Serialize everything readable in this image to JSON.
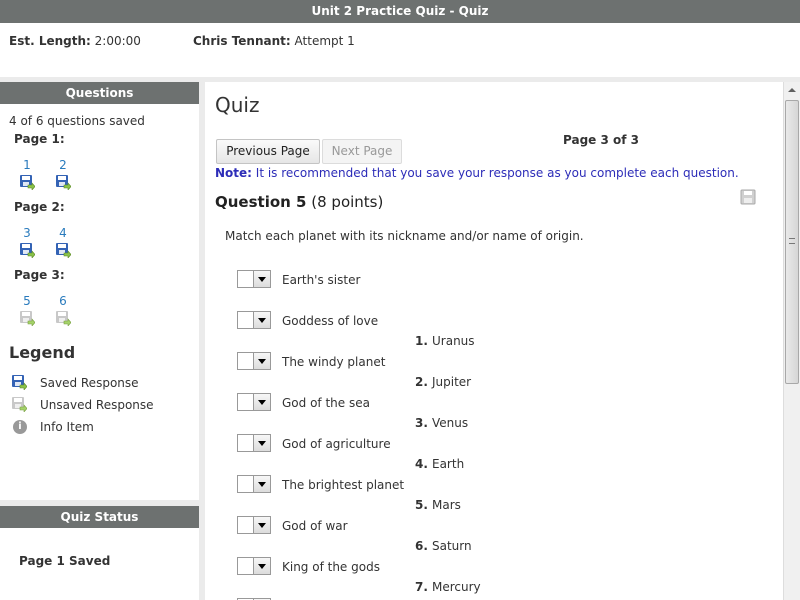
{
  "titlebar": {
    "title": "Unit 2 Practice Quiz - Quiz"
  },
  "meta": {
    "length_label": "Est. Length:",
    "length_value": "2:00:00",
    "user_name": "Chris Tennant:",
    "attempt": "Attempt 1"
  },
  "questions_panel": {
    "header": "Questions",
    "saved_count": "4 of 6 questions saved",
    "pages": [
      {
        "label": "Page 1:",
        "questions": [
          {
            "num": "1",
            "status": "saved"
          },
          {
            "num": "2",
            "status": "saved"
          }
        ]
      },
      {
        "label": "Page 2:",
        "questions": [
          {
            "num": "3",
            "status": "saved"
          },
          {
            "num": "4",
            "status": "saved"
          }
        ]
      },
      {
        "label": "Page 3:",
        "questions": [
          {
            "num": "5",
            "status": "unsaved"
          },
          {
            "num": "6",
            "status": "unsaved"
          }
        ]
      }
    ],
    "legend_title": "Legend",
    "legend": [
      {
        "icon": "saved-disk-icon",
        "label": "Saved Response"
      },
      {
        "icon": "unsaved-disk-icon",
        "label": "Unsaved Response"
      },
      {
        "icon": "info-icon",
        "label": "Info Item"
      }
    ]
  },
  "status_panel": {
    "header": "Quiz Status",
    "text": "Page 1 Saved"
  },
  "main": {
    "title": "Quiz",
    "prev_button": "Previous Page",
    "next_button": "Next Page",
    "page_indicator": "Page 3 of 3",
    "note_label": "Note:",
    "note_text": " It is recommended that you save your response as you complete each question.",
    "question_label": "Question 5",
    "question_points": " (8 points)",
    "instruction": "Match each planet with its nickname and/or name of origin.",
    "prompts": [
      "Earth's sister",
      "Goddess of love",
      "The windy planet",
      "God of the sea",
      "God of agriculture",
      "The brightest planet",
      "God of war",
      "King of the gods"
    ],
    "answers": [
      {
        "num": "1.",
        "text": "Uranus"
      },
      {
        "num": "2.",
        "text": "Jupiter"
      },
      {
        "num": "3.",
        "text": "Venus"
      },
      {
        "num": "4.",
        "text": "Earth"
      },
      {
        "num": "5.",
        "text": "Mars"
      },
      {
        "num": "6.",
        "text": "Saturn"
      },
      {
        "num": "7.",
        "text": "Mercury"
      }
    ]
  },
  "colors": {
    "header_gray": "#6d7170",
    "link_blue": "#2a7bbd",
    "note_blue": "#2c2cb8",
    "sidebar_bg": "#ebebeb"
  }
}
